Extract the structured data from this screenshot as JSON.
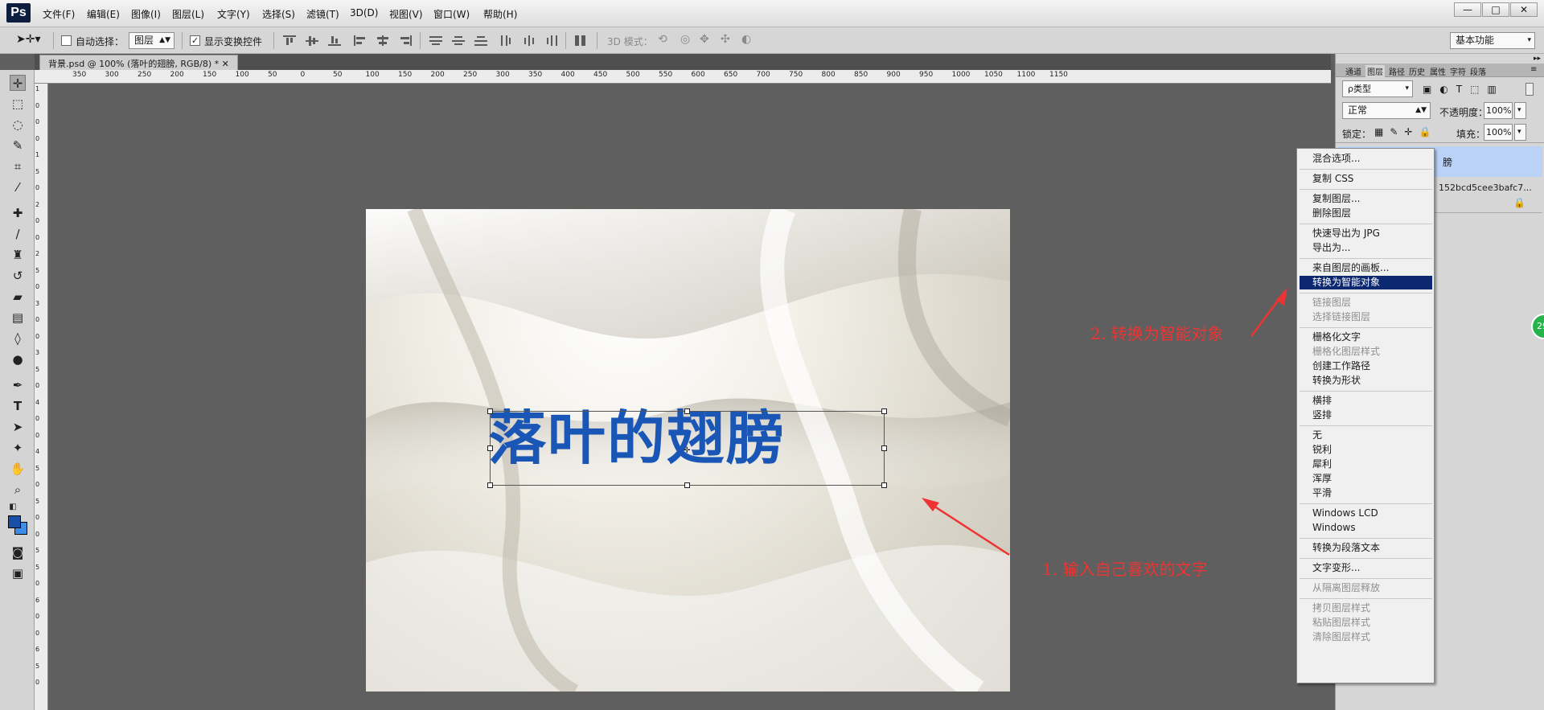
{
  "app": {
    "logo": "Ps"
  },
  "menu": [
    "文件(F)",
    "编辑(E)",
    "图像(I)",
    "图层(L)",
    "文字(Y)",
    "选择(S)",
    "滤镜(T)",
    "3D(D)",
    "视图(V)",
    "窗口(W)",
    "帮助(H)"
  ],
  "window_controls": {
    "minimize": "—",
    "restore": "□",
    "close": "✕"
  },
  "options": {
    "auto_select_label": "自动选择：",
    "auto_select_value": "图层",
    "show_transform_label": "显示变换控件",
    "mode_3d_label": "3D 模式：",
    "workspace": "基本功能"
  },
  "document_tab": "背景.psd @ 100% (落叶的翅膀, RGB/8) *",
  "ruler_h": [
    "350",
    "300",
    "250",
    "200",
    "150",
    "100",
    "50",
    "0",
    "50",
    "100",
    "150",
    "200",
    "250",
    "300",
    "350",
    "400",
    "450",
    "500",
    "550",
    "600",
    "650",
    "700",
    "750",
    "800",
    "850",
    "900",
    "950",
    "1000",
    "1050",
    "1100",
    "1150"
  ],
  "ruler_v": [
    "1",
    "0",
    "0",
    "0",
    "1",
    "5",
    "0",
    "2",
    "0",
    "0",
    "2",
    "5",
    "0",
    "3",
    "0",
    "0",
    "3",
    "5",
    "0",
    "4",
    "0",
    "0",
    "4",
    "5",
    "0",
    "5",
    "0",
    "0",
    "5",
    "5",
    "0",
    "6",
    "0",
    "0",
    "6",
    "5",
    "0"
  ],
  "canvas_text": "落叶的翅膀",
  "annotations": {
    "step1": "1. 输入自己喜欢的文字",
    "step2": "2. 转换为智能对象"
  },
  "panel": {
    "tabs": [
      "通道",
      "图层",
      "路径",
      "历史",
      "属性",
      "字符",
      "段落"
    ],
    "filter_kind": "ρ类型",
    "blend_mode": "正常",
    "opacity_label": "不透明度：",
    "opacity_value": "100%",
    "lock_label": "锁定：",
    "fill_label": "填充：",
    "fill_value": "100%",
    "layer_partial": "膀",
    "layer2_partial": "152bcd5cee3bafc7..."
  },
  "context_menu": [
    {
      "label": "混合选项...",
      "state": "normal"
    },
    {
      "sep": true
    },
    {
      "label": "复制 CSS",
      "state": "normal"
    },
    {
      "sep": true
    },
    {
      "label": "复制图层...",
      "state": "normal"
    },
    {
      "label": "删除图层",
      "state": "normal"
    },
    {
      "sep": true
    },
    {
      "label": "快速导出为 JPG",
      "state": "normal"
    },
    {
      "label": "导出为...",
      "state": "normal"
    },
    {
      "sep": true
    },
    {
      "label": "来自图层的画板...",
      "state": "normal"
    },
    {
      "label": "转换为智能对象",
      "state": "highlight"
    },
    {
      "sep": true
    },
    {
      "label": "链接图层",
      "state": "disabled"
    },
    {
      "label": "选择链接图层",
      "state": "disabled"
    },
    {
      "sep": true
    },
    {
      "label": "栅格化文字",
      "state": "normal"
    },
    {
      "label": "栅格化图层样式",
      "state": "disabled"
    },
    {
      "label": "创建工作路径",
      "state": "normal"
    },
    {
      "label": "转换为形状",
      "state": "normal"
    },
    {
      "sep": true
    },
    {
      "label": "横排",
      "state": "normal"
    },
    {
      "label": "竖排",
      "state": "normal"
    },
    {
      "sep": true
    },
    {
      "label": "无",
      "state": "normal"
    },
    {
      "label": "锐利",
      "state": "normal"
    },
    {
      "label": "犀利",
      "state": "normal"
    },
    {
      "label": "浑厚",
      "state": "normal"
    },
    {
      "label": "平滑",
      "state": "normal"
    },
    {
      "sep": true
    },
    {
      "label": "Windows LCD",
      "state": "normal"
    },
    {
      "label": "Windows",
      "state": "normal"
    },
    {
      "sep": true
    },
    {
      "label": "转换为段落文本",
      "state": "normal"
    },
    {
      "sep": true
    },
    {
      "label": "文字变形...",
      "state": "normal"
    },
    {
      "sep": true
    },
    {
      "label": "从隔离图层释放",
      "state": "disabled"
    },
    {
      "sep": true
    },
    {
      "label": "拷贝图层样式",
      "state": "disabled"
    },
    {
      "label": "粘贴图层样式",
      "state": "disabled"
    },
    {
      "label": "清除图层样式",
      "state": "disabled"
    }
  ],
  "badge": "29",
  "colors": {
    "text_blue": "#1a56b5",
    "menu_highlight": "#0b2870",
    "annotation": "#e33333"
  }
}
